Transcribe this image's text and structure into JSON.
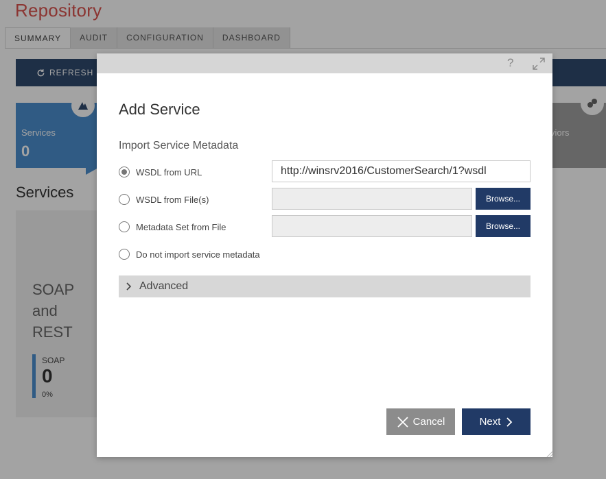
{
  "app": {
    "title": "Repository"
  },
  "tabs": [
    {
      "label": "SUMMARY",
      "active": true
    },
    {
      "label": "AUDIT",
      "active": false
    },
    {
      "label": "CONFIGURATION",
      "active": false
    },
    {
      "label": "DASHBOARD",
      "active": false
    }
  ],
  "toolbar": {
    "refresh_label": "REFRESH"
  },
  "tiles": {
    "services": {
      "label": "Services",
      "value": "0",
      "color": "#4c8fcf"
    },
    "behaviors": {
      "label": "viors"
    }
  },
  "main": {
    "heading": "Services",
    "soap_panel": {
      "title": "SOAP and REST",
      "item_name": "SOAP",
      "item_value": "0",
      "item_pct": "0%"
    }
  },
  "modal": {
    "help_label": "?",
    "title": "Add Service",
    "section_label": "Import Service Metadata",
    "options": [
      {
        "label": "WSDL from URL",
        "checked": true
      },
      {
        "label": "WSDL from File(s)",
        "checked": false
      },
      {
        "label": "Metadata Set from File",
        "checked": false
      },
      {
        "label": "Do not import service metadata",
        "checked": false
      }
    ],
    "url_value": "http://winsrv2016/CustomerSearch/1?wsdl",
    "file_value": "",
    "metadata_file_value": "",
    "browse_label": "Browse...",
    "advanced_label": "Advanced",
    "cancel_label": "Cancel",
    "next_label": "Next"
  },
  "colors": {
    "accent_dark": "#213a66",
    "brand_red": "#d9534f",
    "toolbar": "#2f4a6e"
  }
}
